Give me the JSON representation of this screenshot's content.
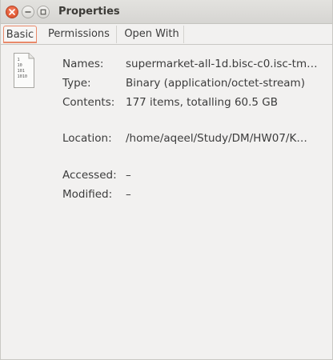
{
  "window": {
    "title": "Properties"
  },
  "tabs": [
    {
      "label": "Basic",
      "active": true
    },
    {
      "label": "Permissions",
      "active": false
    },
    {
      "label": "Open With",
      "active": false
    }
  ],
  "file_icon": {
    "icon": "binary-file-icon",
    "lines": [
      "1",
      "10",
      "101",
      "1010"
    ]
  },
  "properties": {
    "names_label": "Names:",
    "names_value": "supermarket-all-1d.bisc-c0.isc-tm…",
    "type_label": "Type:",
    "type_value": "Binary (application/octet-stream)",
    "contents_label": "Contents:",
    "contents_value": "177 items, totalling 60.5 GB",
    "location_label": "Location:",
    "location_value": "/home/aqeel/Study/DM/HW07/K…",
    "accessed_label": "Accessed:",
    "accessed_value": "–",
    "modified_label": "Modified:",
    "modified_value": "–"
  },
  "colors": {
    "close_button": "#e0562f",
    "active_tab_accent": "#e9896a",
    "background": "#f2f1f0"
  }
}
